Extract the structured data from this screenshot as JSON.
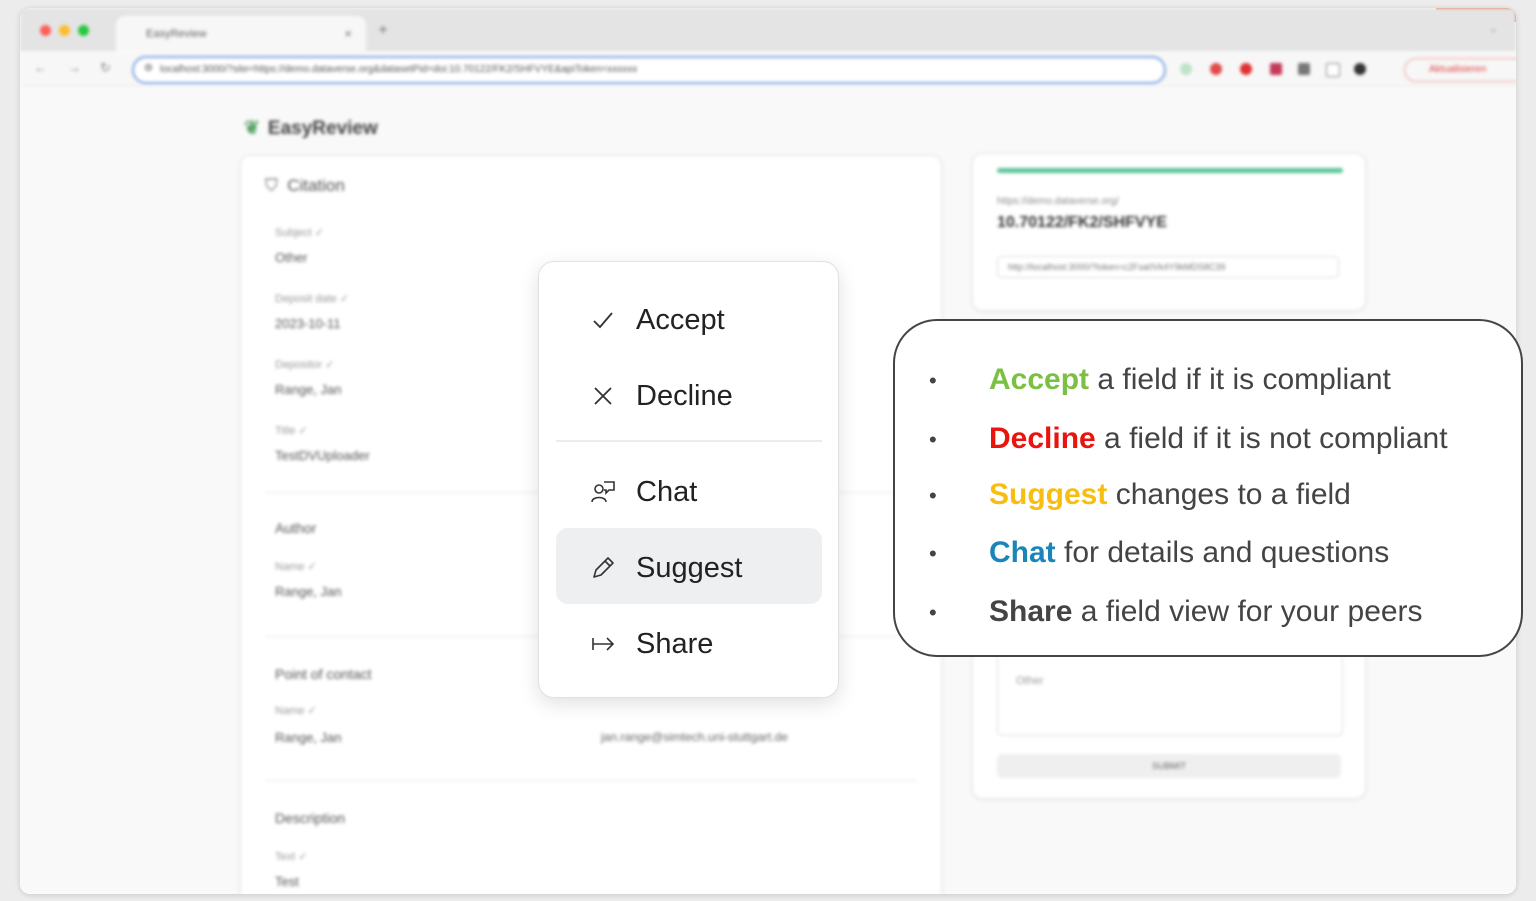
{
  "browser": {
    "tab_title": "EasyReview",
    "tab_close": "×",
    "new_tab": "+",
    "url": "localhost:3000/?site=https://demo.dataverse.org&datasetPid=doi:10.70122/FK2/SHFVYE&apiToken=xxxxxx",
    "update_button": "Aktualisieren",
    "colors": {
      "close": "#ff5f57",
      "min": "#febc2e",
      "max": "#28c840"
    }
  },
  "app": {
    "brand": "EasyReview",
    "citation": {
      "title": "Citation",
      "fields": [
        {
          "label": "Subject ✓",
          "value": "Other"
        },
        {
          "label": "Deposit date ✓",
          "value": "2023-10-11"
        },
        {
          "label": "Depositor ✓",
          "value": "Range, Jan"
        },
        {
          "label": "Title ✓",
          "value": "TestDVUploader"
        }
      ],
      "author": {
        "heading": "Author",
        "label": "Name ✓",
        "value": "Range, Jan"
      },
      "contact": {
        "heading": "Point of contact",
        "label": "Name ✓",
        "value": "Range, Jan",
        "email": "jan.range@simtech.uni-stuttgart.de"
      },
      "description": {
        "heading": "Description",
        "label": "Text ✓",
        "value": "Test"
      }
    },
    "doi_card": {
      "server": "https://demo.dataverse.org/",
      "doi": "10.70122/FK2/SHFVYE",
      "share_link": "http://localhost:3000/?token=c2Fsa0Vk4Y9kMDS8C39",
      "progress": 1.0
    },
    "comment_card": {
      "textarea_text": "Other",
      "submit": "SUBMIT"
    }
  },
  "menu": {
    "items": [
      {
        "label": "Accept",
        "icon": "check-icon"
      },
      {
        "label": "Decline",
        "icon": "close-icon"
      },
      {
        "label": "Chat",
        "icon": "chat-icon"
      },
      {
        "label": "Suggest",
        "icon": "pencil-icon",
        "active": true
      },
      {
        "label": "Share",
        "icon": "share-arrow-icon"
      }
    ]
  },
  "callout": {
    "bullet": "•",
    "rows": [
      {
        "keyword": "Accept",
        "rest": " a field if it is compliant",
        "color": "#7bbf43"
      },
      {
        "keyword": "Decline",
        "rest": " a field if it is not compliant",
        "color": "#e8140d"
      },
      {
        "keyword": "Suggest",
        "rest": " changes to a field",
        "color": "#f7bd10"
      },
      {
        "keyword": "Chat",
        "rest": " for details and questions",
        "color": "#1a86b8"
      },
      {
        "keyword": "Share",
        "rest": " a field view for your peers",
        "color": "#444444"
      }
    ]
  }
}
